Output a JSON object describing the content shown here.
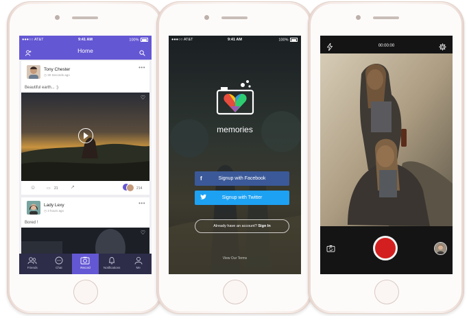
{
  "screen_feed": {
    "status": {
      "carrier": "AT&T",
      "time": "9:41 AM",
      "battery": "100%"
    },
    "header": {
      "title": "Home"
    },
    "posts": [
      {
        "user": "Tony Chester",
        "time": "30 Seconds ago",
        "caption": "Beautiful earth... :)",
        "comments": "21",
        "likes": "214"
      },
      {
        "user": "Lady Lexy",
        "time": "3 hours ago",
        "caption": "Bored !"
      }
    ],
    "tabs": [
      {
        "label": "Friends",
        "icon": "friends-icon"
      },
      {
        "label": "Chat",
        "icon": "chat-icon"
      },
      {
        "label": "Record",
        "icon": "record-icon",
        "active": true
      },
      {
        "label": "Notifications",
        "icon": "bell-icon"
      },
      {
        "label": "Me",
        "icon": "person-icon"
      }
    ],
    "accent": "#6457d3"
  },
  "screen_login": {
    "status": {
      "carrier": "AT&T",
      "time": "9:41 AM",
      "battery": "100%"
    },
    "app_name": "memories",
    "facebook_button": "Signup with Facebook",
    "twitter_button": "Signup with Twitter",
    "account_prompt": "Already have an account?",
    "signin_link": "Sign In",
    "terms": "View Our Terms",
    "colors": {
      "facebook": "#3b5998",
      "twitter": "#1da1f2"
    }
  },
  "screen_camera": {
    "timer": "00:00:00",
    "record_color": "#d31f1f"
  }
}
